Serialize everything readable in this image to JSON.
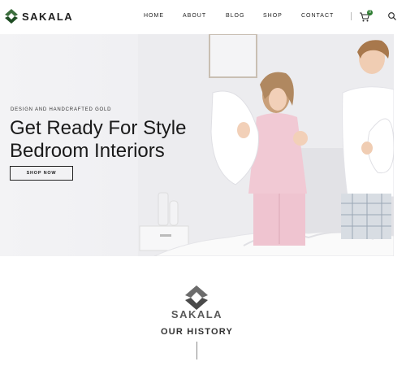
{
  "brand": {
    "name": "SAKALA",
    "accent_color": "#2e7d32"
  },
  "nav": {
    "items": [
      {
        "label": "HOME"
      },
      {
        "label": "ABOUT"
      },
      {
        "label": "BLOG"
      },
      {
        "label": "SHOP"
      },
      {
        "label": "CONTACT"
      }
    ],
    "cart_count": "0",
    "cart_icon": "cart-icon",
    "search_icon": "search-icon"
  },
  "hero": {
    "eyebrow": "DESIGN AND HANDCRAFTED GOLD",
    "headline_line1": "Get Ready For Style",
    "headline_line2": "Bedroom Interiors",
    "cta_label": "SHOP NOW"
  },
  "history": {
    "brand": "SAKALA",
    "title": "OUR HISTORY"
  }
}
